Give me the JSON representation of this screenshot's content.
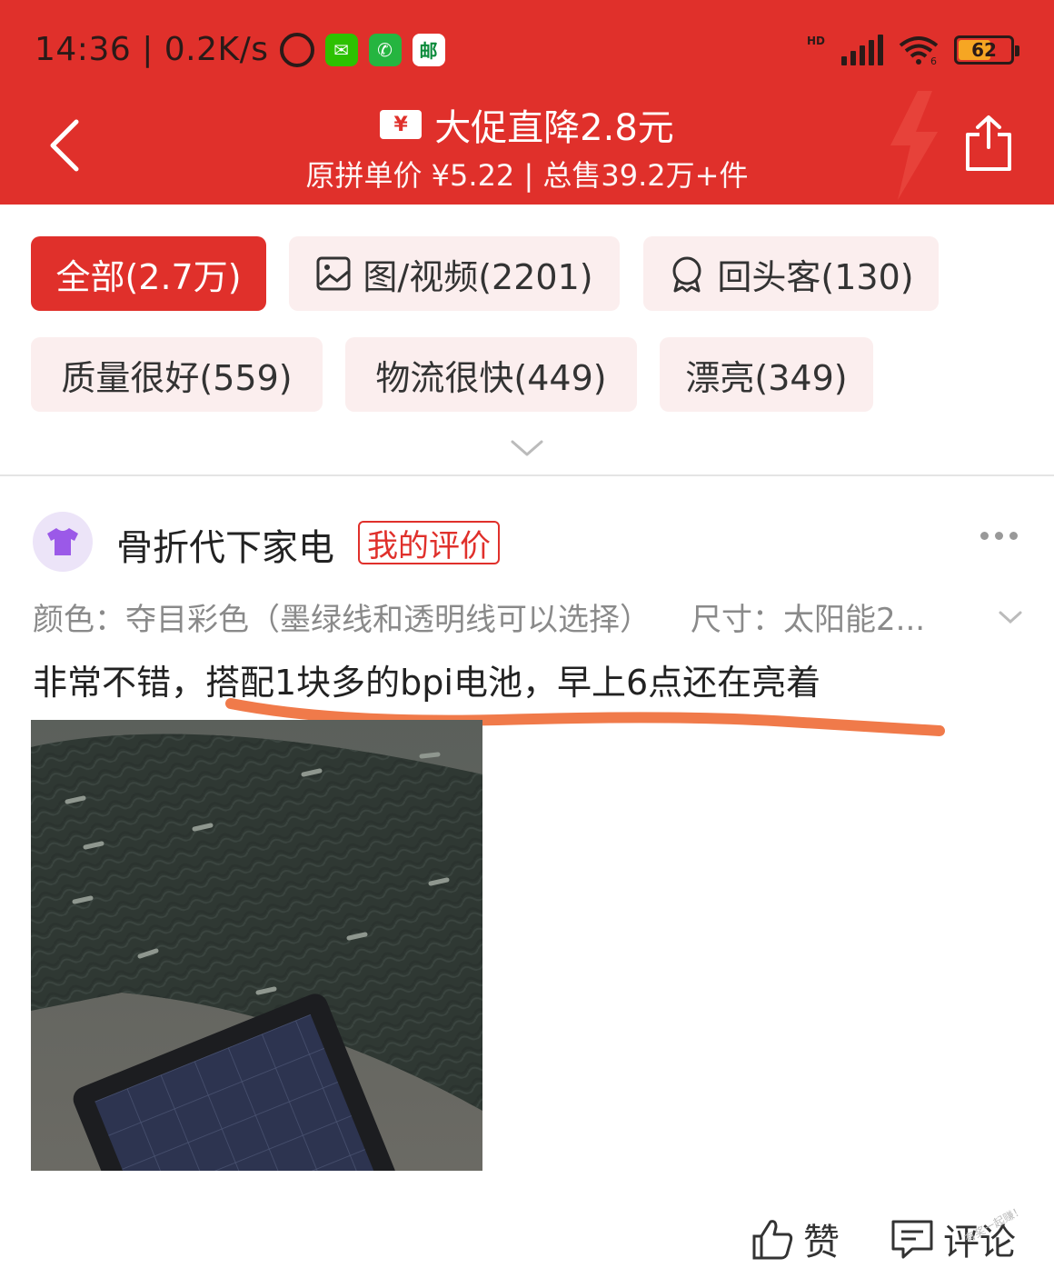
{
  "status_bar": {
    "time": "14:36 | 0.2K/s",
    "hd_label": "HD",
    "wifi_label": "6",
    "battery_level": "62",
    "battery_fraction": 0.62,
    "icons": [
      "alarm-icon",
      "wechat-icon",
      "phone-icon",
      "post-app-icon",
      "signal-icon",
      "wifi-icon",
      "battery-icon"
    ]
  },
  "header": {
    "coupon_symbol": "¥",
    "promo_title": "大促直降2.8元",
    "promo_subtitle": "原拼单价 ¥5.22 | 总售39.2万+件",
    "accent_color": "#e0302b"
  },
  "filters": [
    {
      "label": "全部(2.7万)",
      "active": true
    },
    {
      "label": "图/视频(2201)",
      "active": false
    },
    {
      "label": "回头客(130)",
      "active": false
    },
    {
      "label": "质量很好(559)",
      "active": false
    },
    {
      "label": "物流很快(449)",
      "active": false
    },
    {
      "label": "漂亮(349)",
      "active": false
    }
  ],
  "review": {
    "username": "骨折代下家电",
    "badge": "我的评价",
    "spec_color": "颜色：夺目彩色（墨绿线和透明线可以选择）",
    "spec_size": "尺寸：太阳能2...",
    "text": "非常不错，搭配1块多的bpi电池，早上6点还在亮着",
    "underline_color": "#f07a4a"
  },
  "actions": {
    "like_label": "赞",
    "comment_label": "评论"
  },
  "watermark": "有奖一起赚！"
}
